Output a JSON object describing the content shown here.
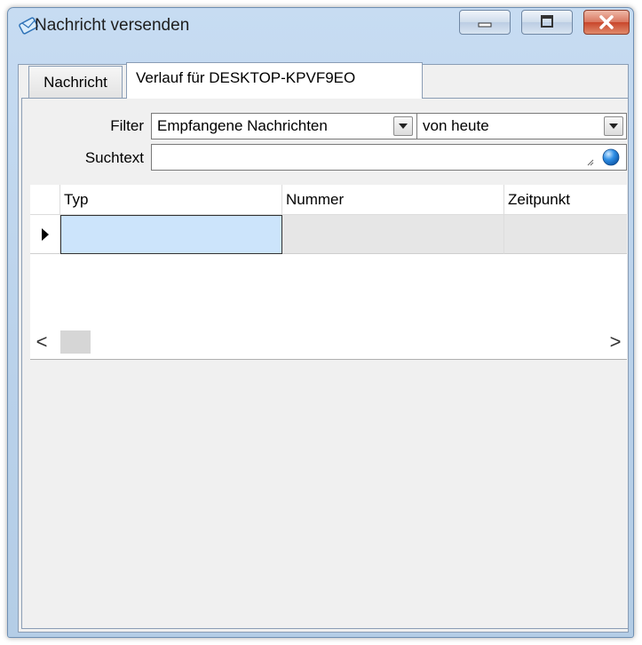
{
  "window": {
    "title": "Nachricht versenden",
    "icon": "message-envelope-icon",
    "controls": [
      "minimize-icon",
      "maximize-icon",
      "close-icon"
    ]
  },
  "tabs": [
    {
      "label": "Nachricht",
      "active": false
    },
    {
      "label": "Verlauf für DESKTOP-KPVF9EO",
      "active": true
    }
  ],
  "filter": {
    "label": "Filter",
    "type_value": "Empfangene Nachrichten",
    "period_value": "von heute"
  },
  "search": {
    "label": "Suchtext",
    "value": "",
    "button_icon": "search-globe-icon"
  },
  "table": {
    "columns": [
      "Typ",
      "Nummer",
      "Zeitpunkt"
    ],
    "rows": [
      {
        "typ": "",
        "nummer": "",
        "zeitpunkt": "",
        "selected": true
      }
    ]
  },
  "scrollbar": {
    "left_arrow": "<",
    "right_arrow": ">"
  },
  "colors": {
    "title_bar": "#b9d1ea",
    "close_button": "#c9462b",
    "selected_cell": "#cce4fb"
  }
}
